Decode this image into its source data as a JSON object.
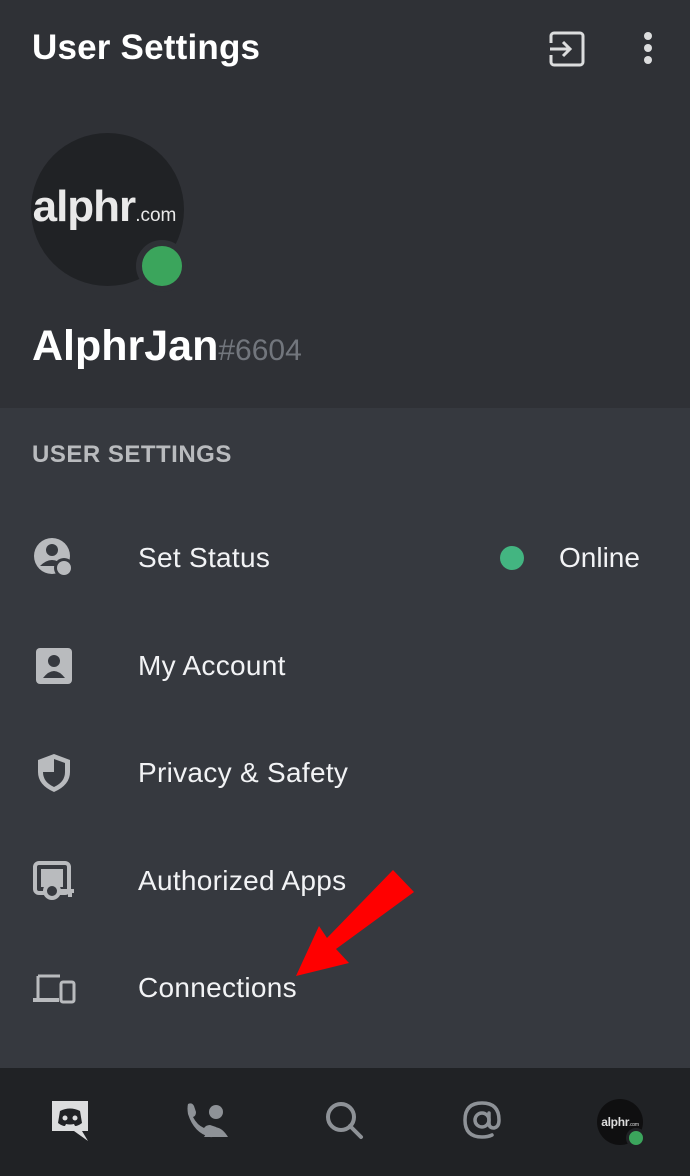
{
  "header": {
    "title": "User Settings",
    "logout_icon": "logout-icon",
    "more_icon": "vertical-dots-icon"
  },
  "profile": {
    "avatar_logo": "alphr",
    "avatar_logo_suffix": ".com",
    "username": "AlphrJan",
    "discriminator": "#6604",
    "status_color": "#3ba55c"
  },
  "section": {
    "label": "USER SETTINGS"
  },
  "menu": {
    "items": [
      {
        "label": "Set Status",
        "icon": "user-status-icon",
        "value": "Online"
      },
      {
        "label": "My Account",
        "icon": "account-card-icon"
      },
      {
        "label": "Privacy & Safety",
        "icon": "shield-icon"
      },
      {
        "label": "Authorized Apps",
        "icon": "authorized-apps-icon"
      },
      {
        "label": "Connections",
        "icon": "devices-icon"
      }
    ]
  },
  "annotation": {
    "arrow_color": "#ff0000"
  },
  "bottom_nav": {
    "items": [
      "discord-home-icon",
      "friends-icon",
      "search-icon",
      "mentions-icon",
      "profile-avatar"
    ],
    "avatar_logo": "alphr",
    "avatar_logo_suffix": ".com"
  }
}
